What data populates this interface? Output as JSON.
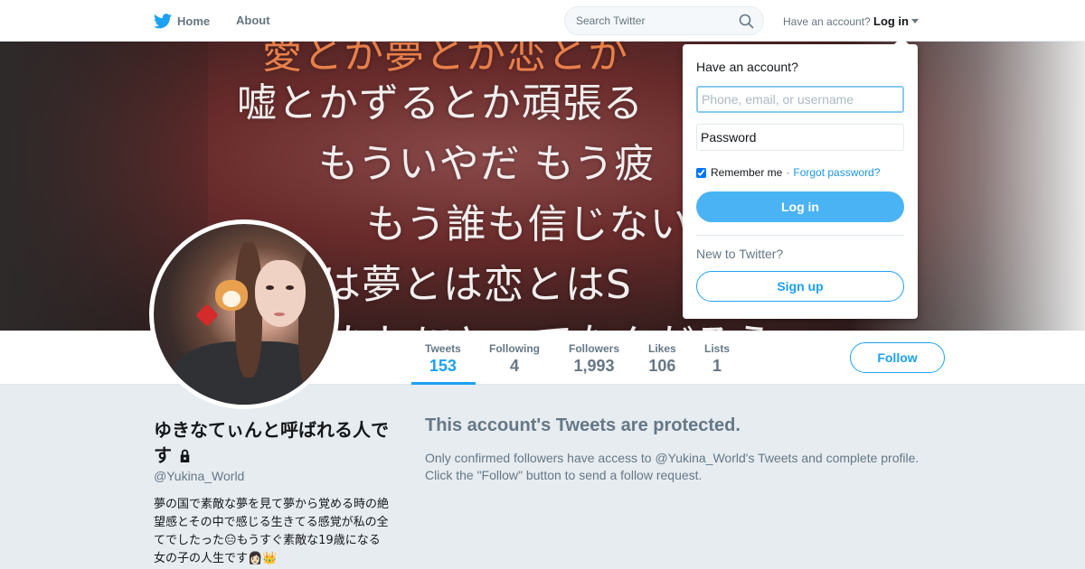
{
  "nav": {
    "home_label": "Home",
    "about_label": "About",
    "search_placeholder": "Search Twitter",
    "account_prompt": "Have an account?",
    "login_label": "Log in"
  },
  "banner": {
    "lines": [
      "愛とか夢とか恋とか",
      "嘘とかずるとか頑張る",
      "もういやだ もう疲",
      "もう誰も信じない",
      "とは夢とは恋とはS",
      "たしにとってなんだろう"
    ]
  },
  "stats": [
    {
      "label": "Tweets",
      "value": "153"
    },
    {
      "label": "Following",
      "value": "4"
    },
    {
      "label": "Followers",
      "value": "1,993"
    },
    {
      "label": "Likes",
      "value": "106"
    },
    {
      "label": "Lists",
      "value": "1"
    }
  ],
  "follow_label": "Follow",
  "profile": {
    "name": "ゆきなてぃんと呼ばれる人です",
    "handle": "@Yukina_World",
    "bio": "夢の国で素敵な夢を見て夢から覚める時の絶望感とその中で感じる生きてる感覚が私の全てでしたった😑もうすぐ素敵な19歳になる女の子の人生です👩🏻👑"
  },
  "protected": {
    "title": "This account's Tweets are protected.",
    "text": "Only confirmed followers have access to @Yukina_World's Tweets and complete profile. Click the \"Follow\" button to send a follow request."
  },
  "login_dropdown": {
    "question": "Have an account?",
    "username_placeholder": "Phone, email, or username",
    "password_placeholder": "Password",
    "remember_label": "Remember me",
    "separator": "·",
    "forgot_label": "Forgot password?",
    "login_button": "Log in",
    "new_prompt": "New to Twitter?",
    "signup_button": "Sign up"
  },
  "colors": {
    "brand": "#1da1f2",
    "login_button": "#4ab3f4",
    "muted": "#657786"
  }
}
